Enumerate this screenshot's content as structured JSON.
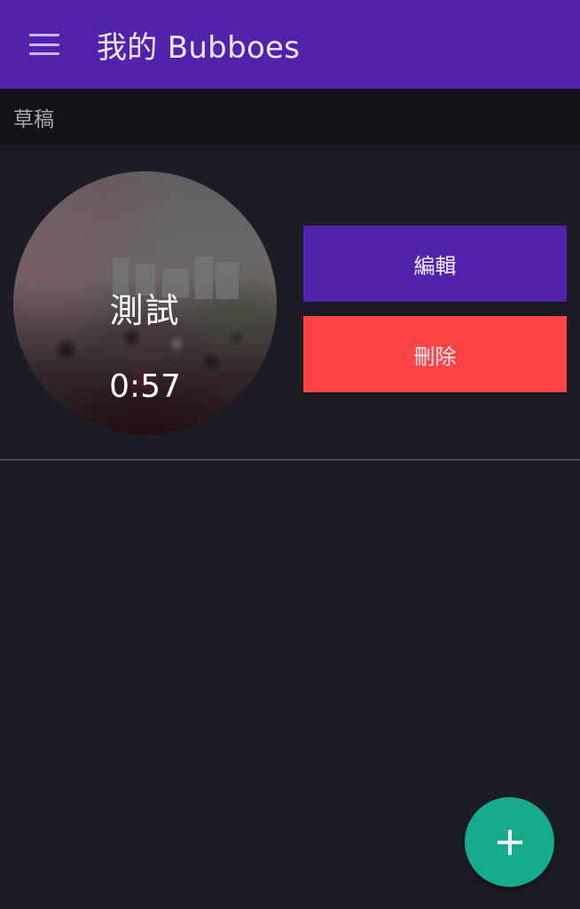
{
  "appbar": {
    "title": "我的 Bubboes",
    "menu_icon": "hamburger-menu-icon"
  },
  "section": {
    "label": "草稿"
  },
  "drafts": [
    {
      "title": "測試",
      "duration": "0:57",
      "thumbnail": "cherry-blossom-crowd-photo",
      "edit_label": "編輯",
      "delete_label": "刪除"
    }
  ],
  "fab": {
    "icon": "plus-icon"
  },
  "colors": {
    "appbar": "#5222ad",
    "background": "#1b1c24",
    "section_header": "#121319",
    "edit_button": "#5222ad",
    "delete_button": "#fe4444",
    "fab": "#16ab8d"
  }
}
